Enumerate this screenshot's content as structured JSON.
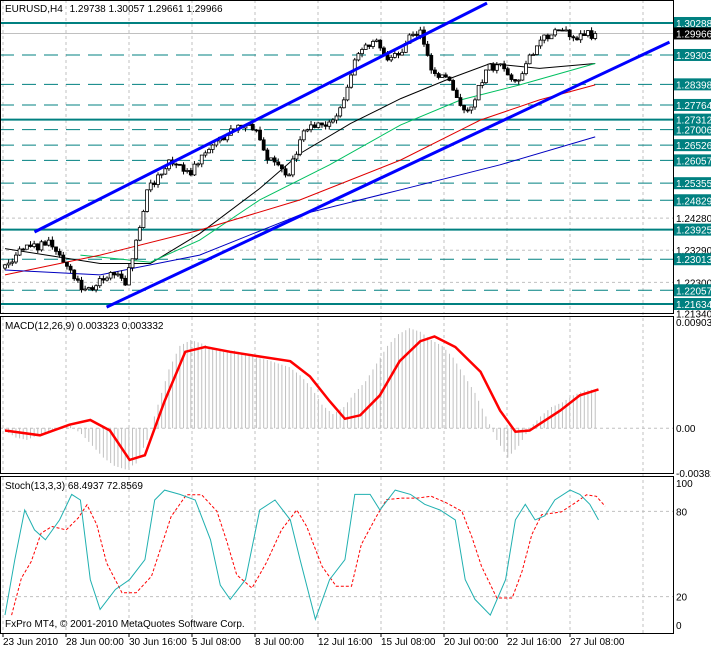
{
  "header": {
    "symbol": "EURUSD,H4",
    "open": "1.29738",
    "high": "1.30057",
    "low": "1.29661",
    "close": "1.29966"
  },
  "macd_header": {
    "name": "MACD(12,26,9)",
    "main": "0.003323",
    "signal": "0.003332"
  },
  "stoch_header": {
    "name": "Stoch(13,3,3)",
    "main": "68.4937",
    "signal": "72.8569"
  },
  "copyright": "FxPro MT4, © 2001-2010 MetaQuotes Software Corp.",
  "colors": {
    "level": "#008080",
    "channel": "#0000ff",
    "ma_fast": "#000000",
    "ma_green": "#00c060",
    "ma_red": "#e00000",
    "ma_blue": "#0000c0",
    "macd_signal": "#ff0000",
    "macd_hist": "#c0c0c0",
    "stoch_main": "#20b0b0",
    "stoch_signal": "#ff0000"
  },
  "chart_data": [
    {
      "type": "candlestick",
      "title": "EURUSD,H4",
      "ylim": [
        1.21357,
        1.30996
      ],
      "closes": [
        1.2284,
        1.2314,
        1.2345,
        1.233,
        1.236,
        1.2314,
        1.2268,
        1.2207,
        1.2207,
        1.2237,
        1.2253,
        1.2222,
        1.236,
        1.2515,
        1.2561,
        1.2607,
        1.2592,
        1.2561,
        1.2622,
        1.2653,
        1.2669,
        1.2699,
        1.2715,
        1.2699,
        1.2607,
        1.2592,
        1.2561,
        1.2669,
        1.2715,
        1.2715,
        1.273,
        1.2792,
        1.2915,
        1.2961,
        1.2976,
        1.2915,
        1.293,
        1.2992,
        1.3007,
        1.2884,
        1.2869,
        1.2822,
        1.2761,
        1.2792,
        1.2884,
        1.29,
        1.2869,
        1.2853,
        1.293,
        1.2976,
        1.2992,
        1.3007,
        1.2983,
        1.299,
        1.29966
      ],
      "current_price": "1.29966",
      "levels_solid": [
        "1.30288",
        "1.27312",
        "1.23925",
        "1.21634"
      ],
      "levels_dashed": [
        "1.29303",
        "1.28398",
        "1.27764",
        "1.27006",
        "1.26526",
        "1.26057",
        "1.25355",
        "1.24829",
        "1.23013",
        "1.22057"
      ],
      "axis_ticks": [
        "1.24280",
        "1.23290",
        "1.22300",
        "1.21340"
      ],
      "channel_upper": [
        [
          2.7,
          1.2385
        ],
        [
          44.1,
          1.309
        ]
      ],
      "channel_lower": [
        [
          9.3,
          1.2154
        ],
        [
          60.8,
          1.297
        ]
      ],
      "moving_averages": [
        {
          "name": "fast",
          "points": [
            [
              0,
              1.2334
            ],
            [
              8.7,
              1.2288
            ],
            [
              13.3,
              1.2288
            ],
            [
              17.8,
              1.238
            ],
            [
              23.3,
              1.2519
            ],
            [
              27,
              1.2627
            ],
            [
              31.6,
              1.2719
            ],
            [
              36.2,
              1.2796
            ],
            [
              40.7,
              1.2858
            ],
            [
              44.4,
              1.2904
            ],
            [
              48.9,
              1.2889
            ],
            [
              54,
              1.2904
            ]
          ]
        },
        {
          "name": "green",
          "points": [
            [
              6.9,
              1.2314
            ],
            [
              13.3,
              1.2292
            ],
            [
              17.8,
              1.236
            ],
            [
              23.3,
              1.2484
            ],
            [
              29.7,
              1.2592
            ],
            [
              36.2,
              1.2715
            ],
            [
              41.7,
              1.2792
            ],
            [
              47.1,
              1.2838
            ],
            [
              54,
              1.2904
            ]
          ]
        },
        {
          "name": "red",
          "points": [
            [
              0,
              1.2253
            ],
            [
              8.7,
              1.2314
            ],
            [
              17.8,
              1.2391
            ],
            [
              27,
              1.2484
            ],
            [
              36.2,
              1.2607
            ],
            [
              43.5,
              1.273
            ],
            [
              48.9,
              1.2792
            ],
            [
              54,
              1.2838
            ]
          ]
        },
        {
          "name": "blue",
          "points": [
            [
              0,
              1.2268
            ],
            [
              8.7,
              1.2253
            ],
            [
              17.8,
              1.2314
            ],
            [
              27,
              1.2438
            ],
            [
              36.2,
              1.2515
            ],
            [
              45.3,
              1.2592
            ],
            [
              54,
              1.2678
            ]
          ]
        }
      ]
    },
    {
      "type": "bar+line",
      "title": "MACD(12,26,9)",
      "ylim": [
        -0.00381,
        0.00903
      ],
      "ticks": [
        "0.00903",
        "0.00",
        "-0.00381"
      ],
      "histogram": [
        -0.0002,
        -0.0008,
        -0.001,
        -0.0006,
        -0.0003,
        0.0,
        0.0002,
        -0.0005,
        -0.0015,
        -0.0025,
        -0.0032,
        -0.0035,
        -0.003,
        -0.001,
        0.002,
        0.005,
        0.007,
        0.0075,
        0.0072,
        0.0068,
        0.0065,
        0.0066,
        0.0063,
        0.006,
        0.0058,
        0.0055,
        0.0052,
        0.0045,
        0.0035,
        0.002,
        0.0012,
        0.0018,
        0.003,
        0.004,
        0.0055,
        0.007,
        0.008,
        0.0085,
        0.0082,
        0.0075,
        0.007,
        0.006,
        0.0045,
        0.003,
        0.001,
        -0.001,
        -0.0025,
        -0.0015,
        0.0,
        0.001,
        0.0018,
        0.0022,
        0.0028,
        0.0032,
        0.0033
      ],
      "signal": [
        [
          0,
          -0.0002
        ],
        [
          3.2,
          -0.0006
        ],
        [
          5.9,
          0.0003
        ],
        [
          7.8,
          0.0007
        ],
        [
          9.6,
          -0.0002
        ],
        [
          11.4,
          -0.0027
        ],
        [
          12.8,
          -0.0023
        ],
        [
          14.6,
          0.0023
        ],
        [
          16.5,
          0.0065
        ],
        [
          18.3,
          0.0069
        ],
        [
          20.6,
          0.0065
        ],
        [
          23.3,
          0.0061
        ],
        [
          26.1,
          0.0057
        ],
        [
          27.9,
          0.0044
        ],
        [
          29.7,
          0.0023
        ],
        [
          31.1,
          0.0008
        ],
        [
          32.5,
          0.0011
        ],
        [
          34.3,
          0.0028
        ],
        [
          36.1,
          0.0057
        ],
        [
          38,
          0.0074
        ],
        [
          39.3,
          0.0078
        ],
        [
          41.2,
          0.0069
        ],
        [
          43.5,
          0.0048
        ],
        [
          45.3,
          0.0015
        ],
        [
          46.7,
          -0.0003
        ],
        [
          48,
          -0.0002
        ],
        [
          50.8,
          0.0015
        ],
        [
          52.6,
          0.0028
        ],
        [
          54.3,
          0.0033
        ]
      ]
    },
    {
      "type": "line",
      "title": "Stoch(13,3,3)",
      "ylim": [
        0,
        100
      ],
      "ticks": [
        "100",
        "80",
        "20",
        "0"
      ],
      "main": [
        [
          0,
          7
        ],
        [
          0.9,
          46
        ],
        [
          1.8,
          81
        ],
        [
          2.7,
          67
        ],
        [
          3.7,
          60
        ],
        [
          5.0,
          74
        ],
        [
          6.1,
          92
        ],
        [
          6.9,
          88
        ],
        [
          7.8,
          32
        ],
        [
          8.7,
          11
        ],
        [
          10.1,
          25
        ],
        [
          11.4,
          32
        ],
        [
          12.8,
          46
        ],
        [
          13.7,
          88
        ],
        [
          14.6,
          95
        ],
        [
          16,
          92
        ],
        [
          17.4,
          88
        ],
        [
          18.8,
          60
        ],
        [
          19.7,
          28
        ],
        [
          20.6,
          18
        ],
        [
          22,
          32
        ],
        [
          23.3,
          81
        ],
        [
          24.7,
          88
        ],
        [
          26.1,
          74
        ],
        [
          27,
          46
        ],
        [
          28.4,
          4
        ],
        [
          29.7,
          32
        ],
        [
          31.1,
          46
        ],
        [
          32,
          92
        ],
        [
          33.4,
          92
        ],
        [
          34.3,
          81
        ],
        [
          35.7,
          95
        ],
        [
          37.1,
          92
        ],
        [
          38.4,
          85
        ],
        [
          39.8,
          81
        ],
        [
          41.2,
          74
        ],
        [
          42.1,
          32
        ],
        [
          43,
          18
        ],
        [
          44.4,
          7
        ],
        [
          45.8,
          32
        ],
        [
          46.7,
          74
        ],
        [
          47.6,
          85
        ],
        [
          48.5,
          74
        ],
        [
          49.4,
          77
        ],
        [
          50.3,
          88
        ],
        [
          51.7,
          95
        ],
        [
          52.6,
          92
        ],
        [
          53.5,
          85
        ],
        [
          54.3,
          74
        ]
      ]
    }
  ],
  "time_axis": [
    "23 Jun 2010",
    "28 Jun 00:00",
    "30 Jun 16:00",
    "5 Jul 08:00",
    "8 Jul 00:00",
    "12 Jul 16:00",
    "15 Jul 08:00",
    "20 Jul 00:00",
    "22 Jul 16:00",
    "27 Jul 08:00"
  ]
}
